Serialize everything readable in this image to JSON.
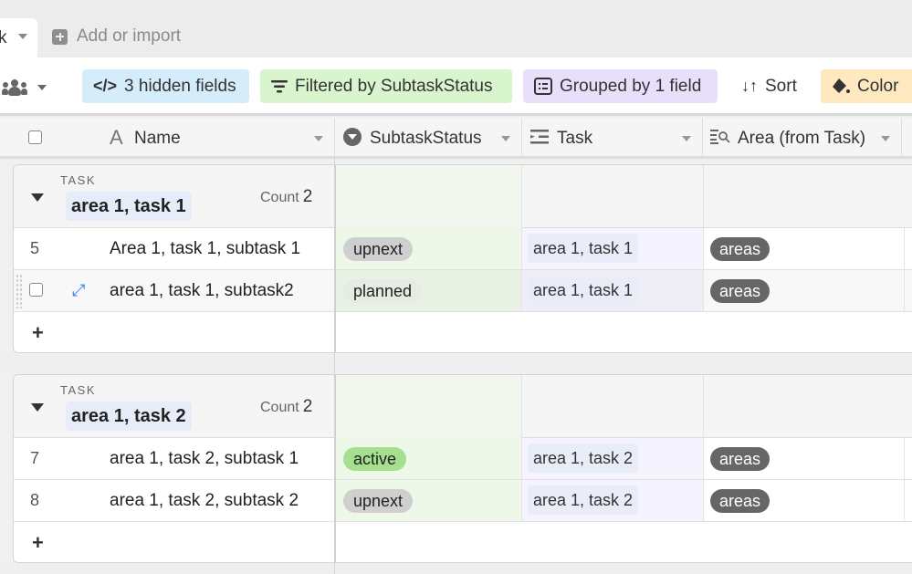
{
  "tabs": {
    "active_tab_partial": "k",
    "add_import_label": "Add or import"
  },
  "toolbar": {
    "hidden_fields": "3 hidden fields",
    "filter": "Filtered by SubtaskStatus",
    "group": "Grouped by 1 field",
    "sort": "Sort",
    "color": "Color"
  },
  "columns": {
    "name": "Name",
    "status": "SubtaskStatus",
    "task": "Task",
    "area": "Area (from Task)"
  },
  "groups": [
    {
      "label": "TASK",
      "name": "area 1, task 1",
      "count_label": "Count",
      "count": "2",
      "rows": [
        {
          "num": "5",
          "name": "Area 1, task 1, subtask 1",
          "status": "upnext",
          "status_color": "#cfcfcf",
          "task": "area 1, task 1",
          "area": "areas"
        },
        {
          "num": "",
          "name": "area 1, task 1, subtask2",
          "status": "planned",
          "status_color": "#eaeaea",
          "task": "area 1, task 1",
          "area": "areas"
        }
      ]
    },
    {
      "label": "TASK",
      "name": "area 1, task 2",
      "count_label": "Count",
      "count": "2",
      "rows": [
        {
          "num": "7",
          "name": "area 1, task 2, subtask 1",
          "status": "active",
          "status_color": "#a6df8f",
          "task": "area 1, task 2",
          "area": "areas"
        },
        {
          "num": "8",
          "name": "area 1, task 2, subtask 2",
          "status": "upnext",
          "status_color": "#cfcfcf",
          "task": "area 1, task 2",
          "area": "areas"
        }
      ]
    }
  ],
  "add_row_symbol": "+"
}
